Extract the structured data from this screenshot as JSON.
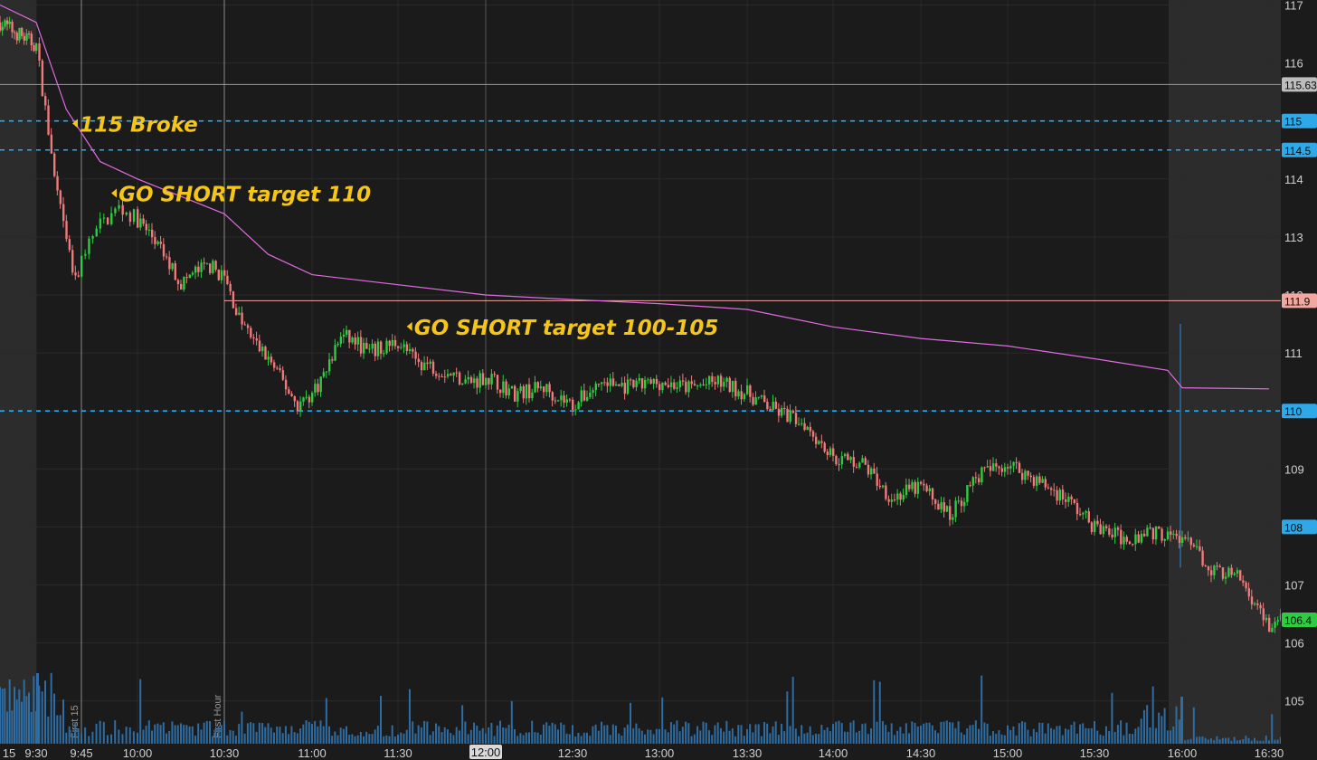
{
  "chart_data": {
    "type": "candlestick",
    "y_axis": {
      "range": [
        104.6,
        117.1
      ],
      "ticks": [
        117,
        116,
        115,
        114,
        113,
        112,
        111,
        110,
        109,
        108,
        107,
        106,
        105
      ]
    },
    "x_axis": {
      "labels": [
        "15",
        "9:30",
        "9:45",
        "10:00",
        "10:30",
        "11:00",
        "11:30",
        "12:00",
        "12:30",
        "13:00",
        "13:30",
        "14:00",
        "14:30",
        "15:00",
        "15:30",
        "16:00",
        "16:30"
      ],
      "highlighted_label": "12:00"
    },
    "sessions": {
      "premarket_shaded": true,
      "afterhours_shaded": true
    },
    "vertical_markers": [
      {
        "label": "First 15",
        "time": "9:45"
      },
      {
        "label": "First Hour",
        "time": "10:30"
      }
    ],
    "horizontal_levels": [
      {
        "value": 115.63,
        "label": "115.63",
        "style": "solid",
        "color": "#9a9a9a"
      },
      {
        "value": 115,
        "label": "115",
        "style": "dashed",
        "color": "#2ea8e6"
      },
      {
        "value": 114.5,
        "label": "114.5",
        "style": "dashed",
        "color": "#2ea8e6"
      },
      {
        "value": 111.9,
        "label": "111.9",
        "style": "solid",
        "color": "#f2a8a0"
      },
      {
        "value": 110,
        "label": "110",
        "style": "dashed",
        "color": "#2ea8e6"
      },
      {
        "value": 108,
        "label": "108",
        "style": "tag",
        "color": "#2ea8e6"
      },
      {
        "value": 106.4,
        "label": "106.4",
        "style": "tag",
        "color": "#2ecc40"
      }
    ],
    "price_path": [
      [
        "9:15",
        116.7
      ],
      [
        "9:30",
        116.3
      ],
      [
        "9:33",
        115.2
      ],
      [
        "9:36",
        114.0
      ],
      [
        "9:40",
        112.9
      ],
      [
        "9:43",
        112.2
      ],
      [
        "9:46",
        112.8
      ],
      [
        "9:50",
        113.2
      ],
      [
        "9:55",
        113.5
      ],
      [
        "10:00",
        113.3
      ],
      [
        "10:05",
        113.0
      ],
      [
        "10:10",
        112.6
      ],
      [
        "10:15",
        112.2
      ],
      [
        "10:20",
        112.4
      ],
      [
        "10:25",
        112.5
      ],
      [
        "10:30",
        112.3
      ],
      [
        "10:35",
        111.6
      ],
      [
        "10:40",
        111.2
      ],
      [
        "10:45",
        110.9
      ],
      [
        "10:50",
        110.5
      ],
      [
        "10:55",
        110.1
      ],
      [
        "11:00",
        110.3
      ],
      [
        "11:05",
        110.7
      ],
      [
        "11:10",
        111.3
      ],
      [
        "11:15",
        111.2
      ],
      [
        "11:20",
        111.0
      ],
      [
        "11:25",
        111.1
      ],
      [
        "11:30",
        111.2
      ],
      [
        "11:35",
        110.9
      ],
      [
        "11:40",
        110.8
      ],
      [
        "11:45",
        110.7
      ],
      [
        "11:50",
        110.6
      ],
      [
        "11:55",
        110.5
      ],
      [
        "12:00",
        110.6
      ],
      [
        "12:10",
        110.3
      ],
      [
        "12:20",
        110.4
      ],
      [
        "12:30",
        110.1
      ],
      [
        "12:40",
        110.5
      ],
      [
        "12:50",
        110.4
      ],
      [
        "13:00",
        110.5
      ],
      [
        "13:10",
        110.4
      ],
      [
        "13:20",
        110.5
      ],
      [
        "13:30",
        110.3
      ],
      [
        "13:40",
        110.0
      ],
      [
        "13:50",
        109.8
      ],
      [
        "14:00",
        109.2
      ],
      [
        "14:10",
        109.1
      ],
      [
        "14:20",
        108.5
      ],
      [
        "14:30",
        108.7
      ],
      [
        "14:40",
        108.2
      ],
      [
        "14:50",
        108.9
      ],
      [
        "15:00",
        109.1
      ],
      [
        "15:10",
        108.8
      ],
      [
        "15:20",
        108.5
      ],
      [
        "15:30",
        108.0
      ],
      [
        "15:40",
        107.8
      ],
      [
        "15:50",
        107.9
      ],
      [
        "16:00",
        107.8
      ],
      [
        "16:10",
        107.3
      ],
      [
        "16:20",
        107.1
      ],
      [
        "16:30",
        106.3
      ],
      [
        "16:35",
        106.4
      ]
    ],
    "vwap": [
      [
        "9:15",
        117.0
      ],
      [
        "9:30",
        116.7
      ],
      [
        "9:40",
        115.2
      ],
      [
        "9:50",
        114.3
      ],
      [
        "10:00",
        114.0
      ],
      [
        "10:30",
        113.4
      ],
      [
        "10:45",
        112.7
      ],
      [
        "11:00",
        112.35
      ],
      [
        "12:00",
        112.0
      ],
      [
        "12:30",
        111.92
      ],
      [
        "13:00",
        111.85
      ],
      [
        "13:30",
        111.75
      ],
      [
        "14:00",
        111.45
      ],
      [
        "14:30",
        111.25
      ],
      [
        "15:00",
        111.12
      ],
      [
        "15:30",
        110.9
      ],
      [
        "15:55",
        110.7
      ],
      [
        "16:00",
        110.4
      ],
      [
        "16:30",
        110.38
      ]
    ],
    "annotations": [
      {
        "text": "115 Broke",
        "time": "9:42",
        "price": 114.8
      },
      {
        "text": "GO SHORT target 110",
        "time": "9:53",
        "price": 113.6
      },
      {
        "text": "GO SHORT target 100-105",
        "time": "11:33",
        "price": 111.3
      }
    ],
    "colors": {
      "up": "#2ecc40",
      "down": "#f07a7a",
      "vwap": "#e06be0",
      "level": "#2ea8e6",
      "annotation": "#f5c518",
      "volume": "#2d6da3",
      "background": "#1b1b1b",
      "session_shade": "#3a3a3a"
    }
  }
}
